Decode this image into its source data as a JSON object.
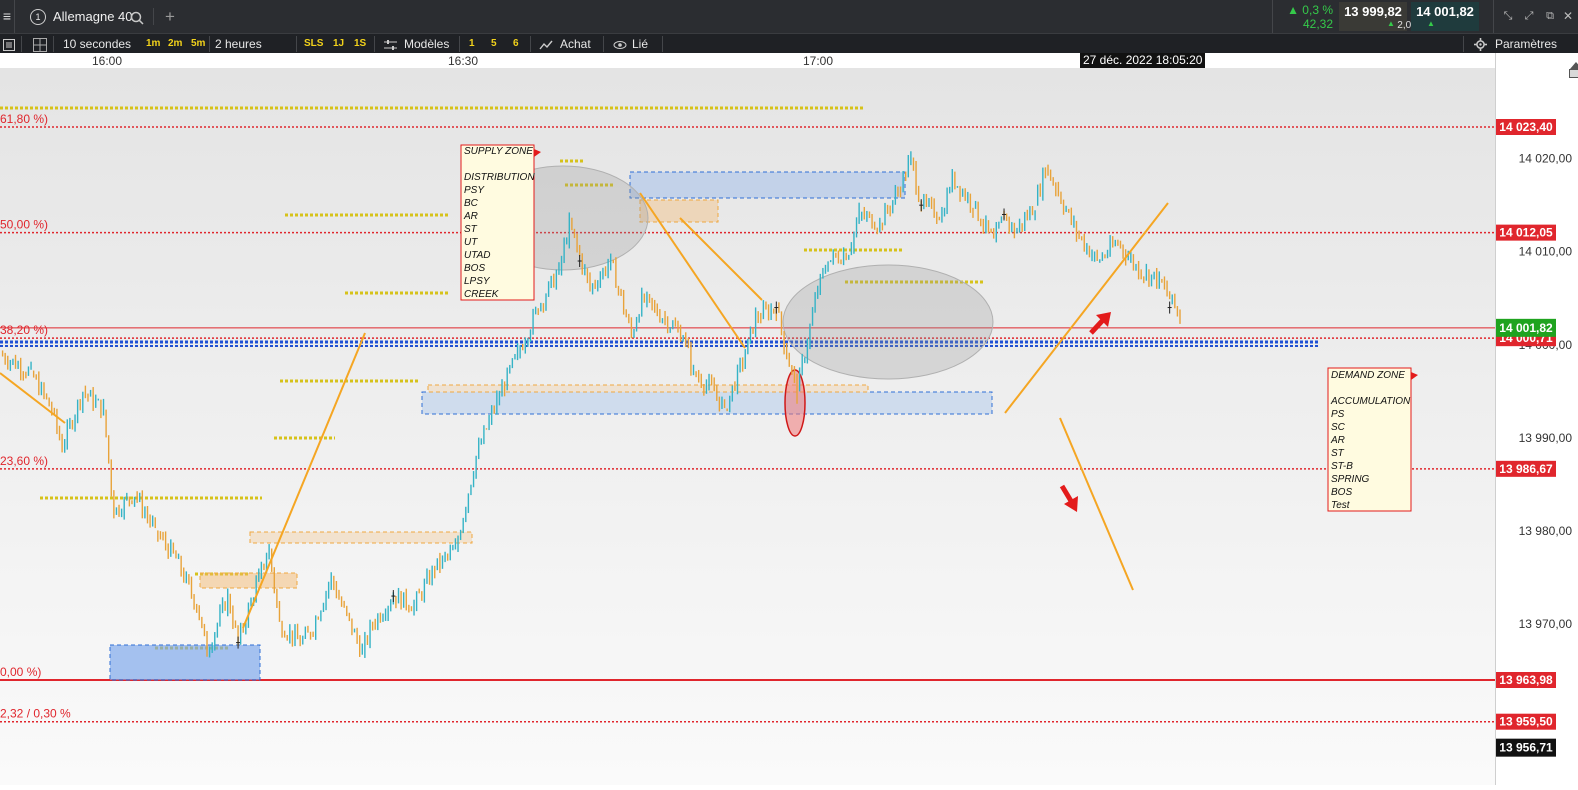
{
  "topbar": {
    "menu_icon": "hamburger-menu-icon",
    "instrument_number": "1",
    "instrument_name": "Allemagne 40",
    "search_icon": "search-icon",
    "add_icon": "plus-icon",
    "change_pct": "▲ 0,3 %",
    "change_abs": "42,32",
    "bid": "13 999,82",
    "ask": "14 001,82",
    "spread": "2,00",
    "window_icons": [
      "collapse-icon",
      "expand-icon",
      "popout-icon",
      "close-icon"
    ],
    "colors": {
      "positive": "#35c94a",
      "bid_bg": "#3a3a36",
      "ask_bg": "#1f3b3d"
    }
  },
  "toolbar": {
    "list_icon": "list-icon",
    "layout_icon": "layout-grid-icon",
    "period": "10 secondes",
    "quick_periods": [
      "1m",
      "2m",
      "5m"
    ],
    "range": "2 heures",
    "quick_ranges": [
      "SLS",
      "1J",
      "1S"
    ],
    "templates_label": "Modèles",
    "templates_icon": "sliders-icon",
    "template_slots": [
      "1",
      "5",
      "6"
    ],
    "buy_label": "Achat",
    "buy_icon": "order-icon",
    "link_label": "Lié",
    "link_icon": "eye-link-icon",
    "settings_label": "Paramètres",
    "settings_icon": "gear-icon"
  },
  "chart_data": {
    "type": "line",
    "title": "",
    "xlabel": "",
    "ylabel": "",
    "x_ticks": [
      "16:00",
      "16:30",
      "17:00"
    ],
    "cursor_label": "27 déc. 2022 18:05:20",
    "ylim": [
      13954,
      14026
    ],
    "y_ticks": [
      {
        "value": 14020,
        "label": "14 020,00"
      },
      {
        "value": 14010,
        "label": "14 010,00"
      },
      {
        "value": 14000,
        "label": "14 000,00"
      },
      {
        "value": 13990,
        "label": "13 990,00"
      },
      {
        "value": 13980,
        "label": "13 980,00"
      },
      {
        "value": 13970,
        "label": "13 970,00"
      }
    ],
    "x_range_minutes": [
      -9,
      105
    ],
    "series": [
      {
        "points": [
          [
            -9,
            13999
          ],
          [
            -6,
            13997
          ],
          [
            -4,
            13993
          ],
          [
            -3,
            13989
          ],
          [
            -1,
            13995
          ],
          [
            1,
            13993
          ],
          [
            2,
            13982
          ],
          [
            4,
            13984
          ],
          [
            6,
            13980
          ],
          [
            8,
            13977
          ],
          [
            10,
            13972
          ],
          [
            11,
            13967
          ],
          [
            13,
            13973
          ],
          [
            14,
            13968
          ],
          [
            16,
            13975
          ],
          [
            17,
            13978
          ],
          [
            18,
            13970
          ],
          [
            20,
            13968
          ],
          [
            21,
            13969
          ],
          [
            23,
            13975
          ],
          [
            24,
            13972
          ],
          [
            26,
            13967
          ],
          [
            27,
            13970
          ],
          [
            29,
            13973
          ],
          [
            31,
            13972
          ],
          [
            33,
            13976
          ],
          [
            35,
            13978
          ],
          [
            37,
            13988
          ],
          [
            39,
            13994
          ],
          [
            41,
            13999
          ],
          [
            43,
            14004
          ],
          [
            45,
            14008
          ],
          [
            46,
            14013
          ],
          [
            48,
            14006
          ],
          [
            50,
            14009
          ],
          [
            52,
            14001
          ],
          [
            53,
            14005
          ],
          [
            55,
            14003
          ],
          [
            57,
            14001
          ],
          [
            58,
            13997
          ],
          [
            60,
            13995
          ],
          [
            61,
            13993
          ],
          [
            63,
            13999
          ],
          [
            64,
            14003
          ],
          [
            66,
            14004
          ],
          [
            67,
            13999
          ],
          [
            68,
            13995
          ],
          [
            70,
            14006
          ],
          [
            71,
            14009
          ],
          [
            73,
            14010
          ],
          [
            74,
            14014
          ],
          [
            76,
            14013
          ],
          [
            78,
            14017
          ],
          [
            79,
            14020
          ],
          [
            80,
            14015
          ],
          [
            82,
            14014
          ],
          [
            83,
            14018
          ],
          [
            85,
            14015
          ],
          [
            87,
            14011
          ],
          [
            88,
            14014
          ],
          [
            89,
            14012
          ],
          [
            91,
            14015
          ],
          [
            92,
            14019
          ],
          [
            93,
            14017
          ],
          [
            95,
            14012
          ],
          [
            97,
            14009
          ],
          [
            99,
            14011
          ],
          [
            101,
            14008
          ],
          [
            103,
            14007
          ],
          [
            105,
            14003
          ]
        ],
        "color": "#e8a33a"
      }
    ],
    "fib_levels": [
      {
        "label": "61,80 %)",
        "price": "14 023,40",
        "value": 14023.4,
        "style": "dotted"
      },
      {
        "label": "50,00 %)",
        "price": "14 012,05",
        "value": 14012.05,
        "style": "dotted"
      },
      {
        "label": "38,20 %)",
        "price": "14 000,71",
        "value": 14000.71,
        "style": "dotted"
      },
      {
        "label": "23,60 %)",
        "price": "13 986,67",
        "value": 13986.67,
        "style": "dotted"
      },
      {
        "label": "0,00 %)",
        "price": "13 963,98",
        "value": 13963.98,
        "style": "solid"
      },
      {
        "label": "2,32 / 0,30 %",
        "price": "13 959,50",
        "value": 13959.5,
        "style": "dotted"
      }
    ],
    "last_price": {
      "label": "14 001,82",
      "value": 14001.82
    },
    "low_marker": {
      "label": "13 956,71",
      "value": 13956.71
    },
    "supply_zone": {
      "title": "SUPPLY ZONE",
      "items": [
        "",
        "DISTRIBUTION",
        "PSY",
        "BC",
        "AR",
        "ST",
        "UT",
        "UTAD",
        "BOS",
        "LPSY",
        "CREEK"
      ]
    },
    "demand_zone": {
      "title": "DEMAND ZONE",
      "items": [
        "",
        "ACCUMULATION",
        "PS",
        "SC",
        "AR",
        "ST",
        "ST-B",
        "SPRING",
        "BOS",
        "Test"
      ]
    },
    "colors": {
      "fib": "#e0262d",
      "candle_up": "#35b3c6",
      "candle_down": "#e8a33a",
      "trendline": "#f5a623",
      "level_yellow": "#d6c21a",
      "blue_zone": "#2f6fd6",
      "last_price_bg": "#1fa31f"
    }
  }
}
